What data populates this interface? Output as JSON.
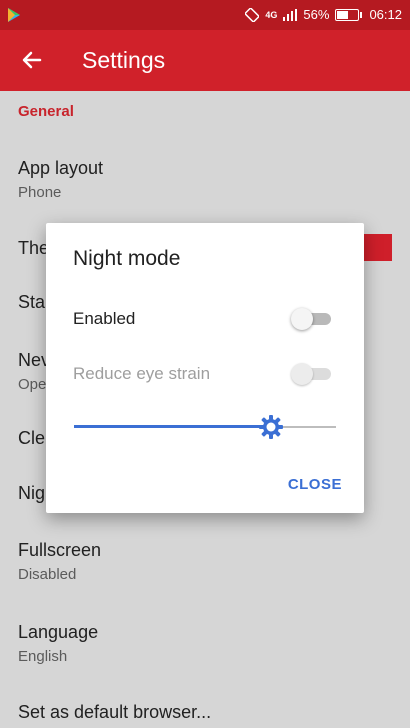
{
  "status_bar": {
    "signal_text": "4G",
    "battery_percent": "56%",
    "battery_level": 0.56,
    "time": "06:12"
  },
  "app_bar": {
    "title": "Settings"
  },
  "settings": {
    "section": "General",
    "items": [
      {
        "title": "App layout",
        "summary": "Phone"
      },
      {
        "title": "The",
        "summary": ""
      },
      {
        "title": "Sta",
        "summary": ""
      },
      {
        "title": "Nev",
        "summary": "Ope"
      },
      {
        "title": "Cle",
        "summary": ""
      },
      {
        "title": "Nig",
        "summary": ""
      },
      {
        "title": "Fullscreen",
        "summary": "Disabled"
      },
      {
        "title": "Language",
        "summary": "English"
      },
      {
        "title": "Set as default browser...",
        "summary": ""
      }
    ]
  },
  "dialog": {
    "title": "Night mode",
    "enabled_label": "Enabled",
    "enabled_on": false,
    "reduce_label": "Reduce eye strain",
    "reduce_on": false,
    "brightness_level": 0.75,
    "close_label": "CLOSE"
  },
  "colors": {
    "accent_red": "#d0212a",
    "status_red": "#b51a21",
    "slider_blue": "#3b6fd4"
  }
}
